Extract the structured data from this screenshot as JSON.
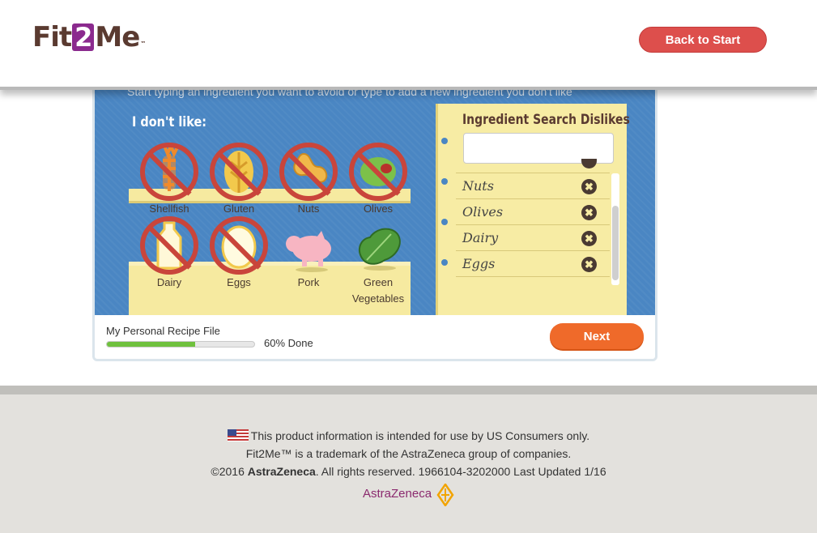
{
  "header": {
    "logo": {
      "part1": "Fit",
      "part2": "2",
      "part3": "Me",
      "tm": "™"
    },
    "back_label": "Back to Start"
  },
  "board": {
    "partial_instruction": "Start typing an ingredient you want to avoid or type to add a new ingredient you don't like",
    "dislike_title": "I don't like:",
    "foods": [
      {
        "label": "Shellfish",
        "crossed": true,
        "icon": "shellfish-icon"
      },
      {
        "label": "Gluten",
        "crossed": true,
        "icon": "wheat-icon"
      },
      {
        "label": "Nuts",
        "crossed": true,
        "icon": "peanut-icon"
      },
      {
        "label": "Olives",
        "crossed": true,
        "icon": "olive-icon"
      },
      {
        "label": "Dairy",
        "crossed": true,
        "icon": "milk-icon"
      },
      {
        "label": "Eggs",
        "crossed": true,
        "icon": "egg-icon"
      },
      {
        "label": "Pork",
        "crossed": false,
        "icon": "pig-icon"
      },
      {
        "label": "Green Vegetables",
        "crossed": false,
        "icon": "greens-icon"
      }
    ]
  },
  "notepad": {
    "title": "Ingredient Search Dislikes",
    "search_value": "",
    "items": [
      "Nuts",
      "Olives",
      "Dairy",
      "Eggs"
    ],
    "remove_glyph": "✖"
  },
  "progress": {
    "label": "My Personal Recipe File",
    "percent": 60,
    "done_text": "60% Done"
  },
  "next_label": "Next",
  "footer": {
    "line1": "This product information is intended for use by US Consumers only.",
    "line2": "Fit2Me™ is a trademark of the AstraZeneca group of companies.",
    "line3_prefix": "©2016 ",
    "line3_brand": "AstraZeneca",
    "line3_suffix": ". All rights reserved. 1966104-3202000 Last Updated 1/16",
    "az_logo": "AstraZeneca"
  },
  "colors": {
    "accent_red": "#dd4f4c",
    "next_orange": "#ef6a2a",
    "board_blue": "#4a86c3",
    "progress_green": "#6fc13d",
    "brand_purple": "#8b2a8e"
  }
}
